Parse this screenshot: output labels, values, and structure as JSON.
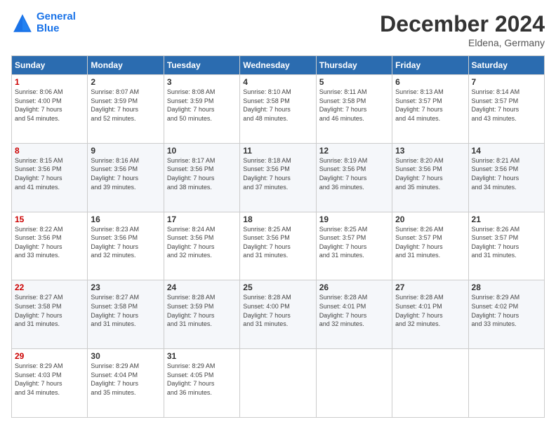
{
  "header": {
    "logo_text_general": "General",
    "logo_text_blue": "Blue",
    "month_title": "December 2024",
    "location": "Eldena, Germany"
  },
  "weekdays": [
    "Sunday",
    "Monday",
    "Tuesday",
    "Wednesday",
    "Thursday",
    "Friday",
    "Saturday"
  ],
  "weeks": [
    [
      {
        "day": "1",
        "sunrise": "8:06 AM",
        "sunset": "4:00 PM",
        "daylight": "7 hours and 54 minutes."
      },
      {
        "day": "2",
        "sunrise": "8:07 AM",
        "sunset": "3:59 PM",
        "daylight": "7 hours and 52 minutes."
      },
      {
        "day": "3",
        "sunrise": "8:08 AM",
        "sunset": "3:59 PM",
        "daylight": "7 hours and 50 minutes."
      },
      {
        "day": "4",
        "sunrise": "8:10 AM",
        "sunset": "3:58 PM",
        "daylight": "7 hours and 48 minutes."
      },
      {
        "day": "5",
        "sunrise": "8:11 AM",
        "sunset": "3:58 PM",
        "daylight": "7 hours and 46 minutes."
      },
      {
        "day": "6",
        "sunrise": "8:13 AM",
        "sunset": "3:57 PM",
        "daylight": "7 hours and 44 minutes."
      },
      {
        "day": "7",
        "sunrise": "8:14 AM",
        "sunset": "3:57 PM",
        "daylight": "7 hours and 43 minutes."
      }
    ],
    [
      {
        "day": "8",
        "sunrise": "8:15 AM",
        "sunset": "3:56 PM",
        "daylight": "7 hours and 41 minutes."
      },
      {
        "day": "9",
        "sunrise": "8:16 AM",
        "sunset": "3:56 PM",
        "daylight": "7 hours and 39 minutes."
      },
      {
        "day": "10",
        "sunrise": "8:17 AM",
        "sunset": "3:56 PM",
        "daylight": "7 hours and 38 minutes."
      },
      {
        "day": "11",
        "sunrise": "8:18 AM",
        "sunset": "3:56 PM",
        "daylight": "7 hours and 37 minutes."
      },
      {
        "day": "12",
        "sunrise": "8:19 AM",
        "sunset": "3:56 PM",
        "daylight": "7 hours and 36 minutes."
      },
      {
        "day": "13",
        "sunrise": "8:20 AM",
        "sunset": "3:56 PM",
        "daylight": "7 hours and 35 minutes."
      },
      {
        "day": "14",
        "sunrise": "8:21 AM",
        "sunset": "3:56 PM",
        "daylight": "7 hours and 34 minutes."
      }
    ],
    [
      {
        "day": "15",
        "sunrise": "8:22 AM",
        "sunset": "3:56 PM",
        "daylight": "7 hours and 33 minutes."
      },
      {
        "day": "16",
        "sunrise": "8:23 AM",
        "sunset": "3:56 PM",
        "daylight": "7 hours and 32 minutes."
      },
      {
        "day": "17",
        "sunrise": "8:24 AM",
        "sunset": "3:56 PM",
        "daylight": "7 hours and 32 minutes."
      },
      {
        "day": "18",
        "sunrise": "8:25 AM",
        "sunset": "3:56 PM",
        "daylight": "7 hours and 31 minutes."
      },
      {
        "day": "19",
        "sunrise": "8:25 AM",
        "sunset": "3:57 PM",
        "daylight": "7 hours and 31 minutes."
      },
      {
        "day": "20",
        "sunrise": "8:26 AM",
        "sunset": "3:57 PM",
        "daylight": "7 hours and 31 minutes."
      },
      {
        "day": "21",
        "sunrise": "8:26 AM",
        "sunset": "3:57 PM",
        "daylight": "7 hours and 31 minutes."
      }
    ],
    [
      {
        "day": "22",
        "sunrise": "8:27 AM",
        "sunset": "3:58 PM",
        "daylight": "7 hours and 31 minutes."
      },
      {
        "day": "23",
        "sunrise": "8:27 AM",
        "sunset": "3:58 PM",
        "daylight": "7 hours and 31 minutes."
      },
      {
        "day": "24",
        "sunrise": "8:28 AM",
        "sunset": "3:59 PM",
        "daylight": "7 hours and 31 minutes."
      },
      {
        "day": "25",
        "sunrise": "8:28 AM",
        "sunset": "4:00 PM",
        "daylight": "7 hours and 31 minutes."
      },
      {
        "day": "26",
        "sunrise": "8:28 AM",
        "sunset": "4:01 PM",
        "daylight": "7 hours and 32 minutes."
      },
      {
        "day": "27",
        "sunrise": "8:28 AM",
        "sunset": "4:01 PM",
        "daylight": "7 hours and 32 minutes."
      },
      {
        "day": "28",
        "sunrise": "8:29 AM",
        "sunset": "4:02 PM",
        "daylight": "7 hours and 33 minutes."
      }
    ],
    [
      {
        "day": "29",
        "sunrise": "8:29 AM",
        "sunset": "4:03 PM",
        "daylight": "7 hours and 34 minutes."
      },
      {
        "day": "30",
        "sunrise": "8:29 AM",
        "sunset": "4:04 PM",
        "daylight": "7 hours and 35 minutes."
      },
      {
        "day": "31",
        "sunrise": "8:29 AM",
        "sunset": "4:05 PM",
        "daylight": "7 hours and 36 minutes."
      },
      null,
      null,
      null,
      null
    ]
  ]
}
